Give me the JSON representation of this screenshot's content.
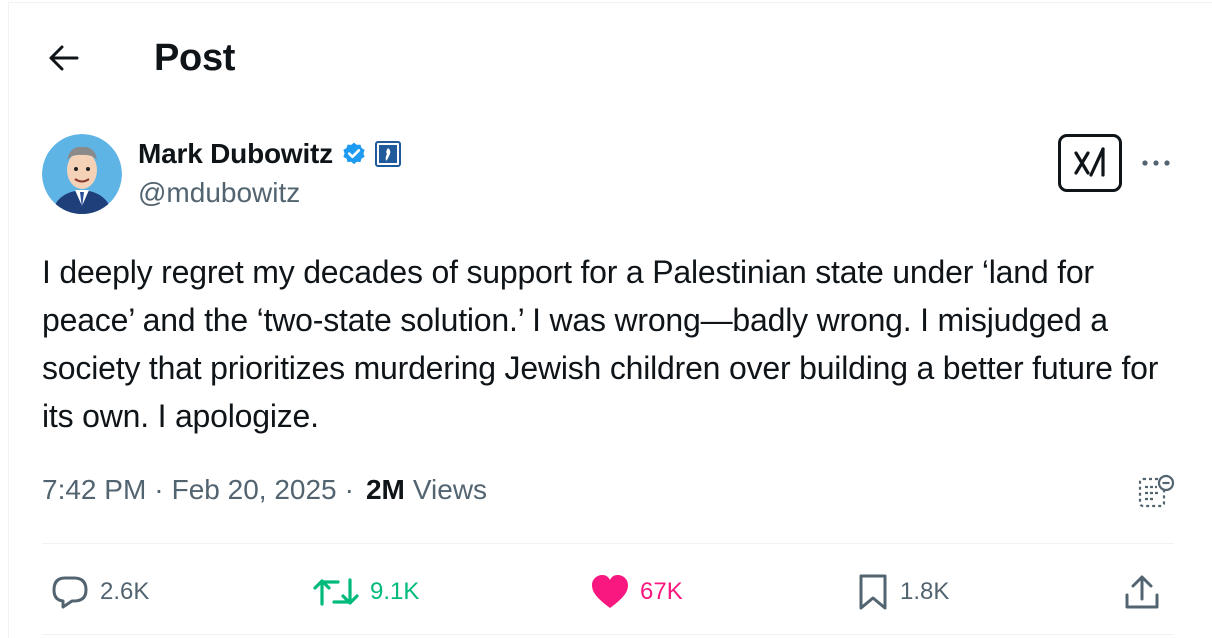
{
  "header": {
    "title": "Post",
    "back_icon": "arrow-left-icon"
  },
  "author": {
    "display_name": "Mark Dubowitz",
    "handle": "@mdubowitz",
    "verified_color": "#1d9bf0",
    "affiliation_badge_color": "#1f5a9a"
  },
  "tweet": {
    "text": "I deeply regret my decades of support for a Palestinian state under ‘land for peace’ and the ‘two-state solution.’ I was wrong—badly wrong. I misjudged a society that prioritizes murdering Jewish children over building a better future for its own. I apologize.",
    "time": "7:42 PM",
    "separator": "·",
    "date": "Feb 20, 2025",
    "views_count": "2M",
    "views_label": "Views"
  },
  "actions": {
    "replies": "2.6K",
    "reposts": "9.1K",
    "likes": "67K",
    "bookmarks": "1.8K"
  },
  "colors": {
    "text_primary": "#0f1419",
    "text_secondary": "#536471",
    "repost_green": "#00ba7c",
    "like_pink": "#f91880",
    "divider": "#eff3f4"
  }
}
